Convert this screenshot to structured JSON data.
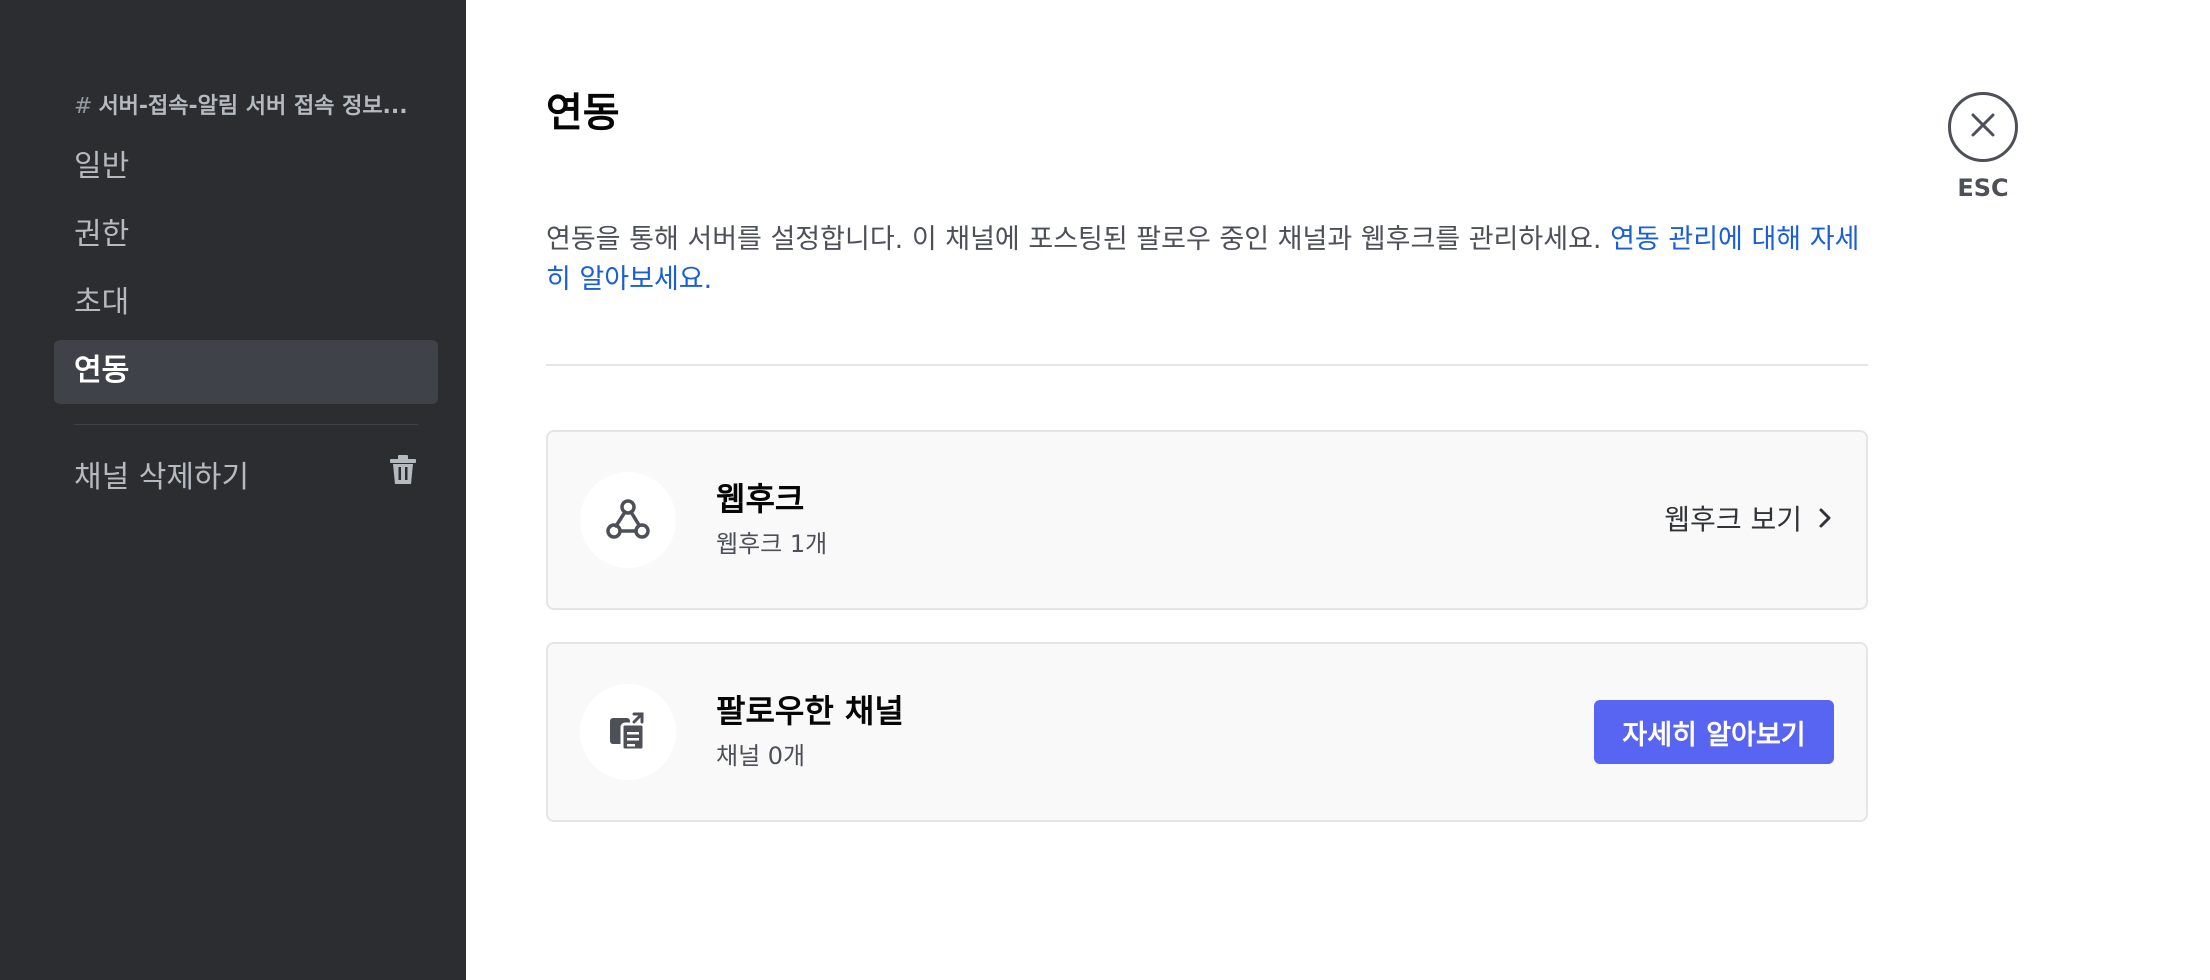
{
  "sidebar": {
    "channel_heading": "서버-접속-알림 서버 접속 정보...",
    "hash_symbol": "#",
    "items": [
      {
        "label": "일반"
      },
      {
        "label": "권한"
      },
      {
        "label": "초대"
      },
      {
        "label": "연동",
        "selected": true
      }
    ],
    "delete_label": "채널 삭제하기",
    "delete_icon": "trash-icon"
  },
  "main": {
    "title": "연동",
    "description": "연동을 통해 서버를 설정합니다. 이 채널에 포스팅된 팔로우 중인 채널과 웹후크를 관리하세요.",
    "learn_more_link": "연동 관리에 대해 자세히 알아보세요.",
    "cards": [
      {
        "title": "웹후크",
        "subtitle": "웹후크 1개",
        "action_label": "웹후크 보기",
        "icon": "webhook-icon"
      },
      {
        "title": "팔로우한 채널",
        "subtitle": "채널 0개",
        "action_label": "자세히 알아보기",
        "icon": "followed-channel-icon"
      }
    ]
  },
  "close": {
    "label": "ESC",
    "icon": "close-icon"
  },
  "colors": {
    "sidebar_bg": "#2b2d31",
    "selected_bg": "#404249",
    "brand": "#5865f2",
    "link": "#1a5fd6"
  }
}
